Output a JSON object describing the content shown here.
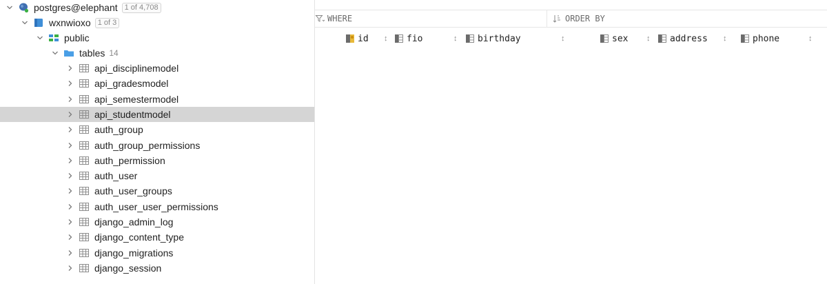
{
  "tree": {
    "connection": {
      "label": "postgres@elephant",
      "badge": "1 of 4,708"
    },
    "database": {
      "label": "wxnwioxo",
      "badge": "1 of 3"
    },
    "schema": {
      "label": "public"
    },
    "tables_folder": {
      "label": "tables",
      "count": "14"
    },
    "tables": [
      {
        "label": "api_disciplinemodel",
        "selected": false
      },
      {
        "label": "api_gradesmodel",
        "selected": false
      },
      {
        "label": "api_semestermodel",
        "selected": false
      },
      {
        "label": "api_studentmodel",
        "selected": true
      },
      {
        "label": "auth_group",
        "selected": false
      },
      {
        "label": "auth_group_permissions",
        "selected": false
      },
      {
        "label": "auth_permission",
        "selected": false
      },
      {
        "label": "auth_user",
        "selected": false
      },
      {
        "label": "auth_user_groups",
        "selected": false
      },
      {
        "label": "auth_user_user_permissions",
        "selected": false
      },
      {
        "label": "django_admin_log",
        "selected": false
      },
      {
        "label": "django_content_type",
        "selected": false
      },
      {
        "label": "django_migrations",
        "selected": false
      },
      {
        "label": "django_session",
        "selected": false
      }
    ]
  },
  "grid": {
    "where_label": "WHERE",
    "order_label": "ORDER BY",
    "sort_glyph": "↕",
    "columns": [
      "id",
      "fio",
      "birthday",
      "sex",
      "address",
      "phone"
    ]
  },
  "colors": {
    "selection": "#d5d5d5",
    "folder": "#4a9fe6",
    "table_icon": "#8c8c8c",
    "db_icon": "#3f8fd8"
  }
}
